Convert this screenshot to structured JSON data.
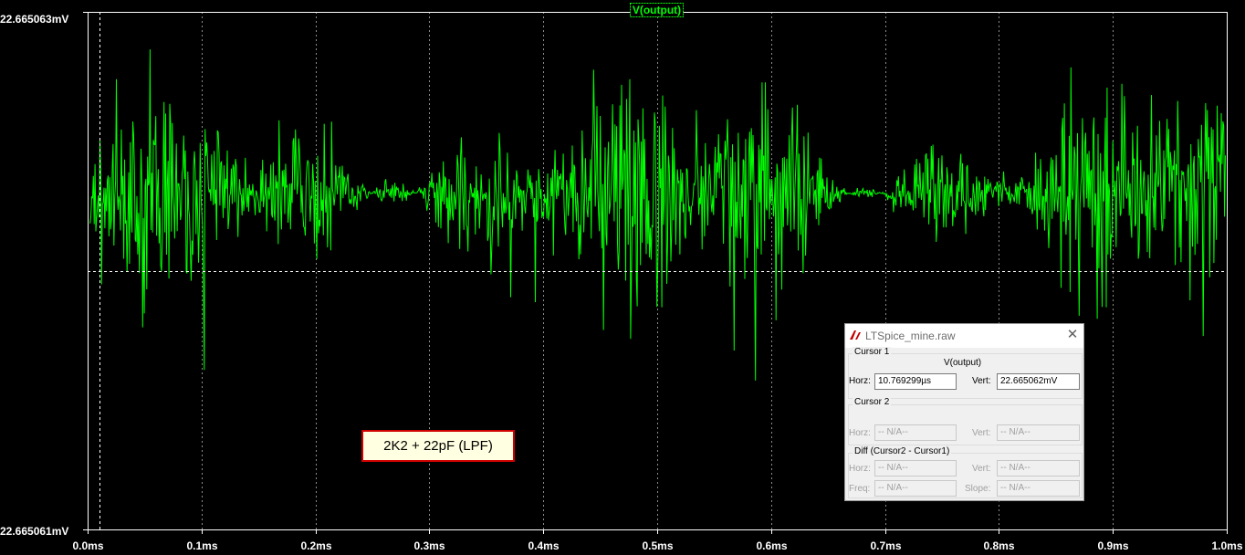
{
  "chart_data": {
    "type": "line",
    "title": "V(output)",
    "series": [
      {
        "name": "V(output)",
        "color": "#00ff00"
      }
    ],
    "x_ticks": [
      "0.0ms",
      "0.1ms",
      "0.2ms",
      "0.3ms",
      "0.4ms",
      "0.5ms",
      "0.6ms",
      "0.7ms",
      "0.8ms",
      "0.9ms",
      "1.0ms"
    ],
    "y_tick_top": "22.665063mV",
    "y_tick_bottom": "22.665061mV",
    "xlim_ms": [
      0.0,
      1.0
    ],
    "ylim_mV": [
      22.665061,
      22.665063
    ],
    "series_description_note_free": true,
    "noise_center_mV": 22.6650623,
    "cursor_x_ms": 0.010769299,
    "cursor_y_mV": 22.665062,
    "grid": true,
    "background": "#000000",
    "axis_color": "#ffffff",
    "grid_color": "#8c8c8c"
  },
  "annotation": {
    "text": "2K2 + 22pF (LPF)"
  },
  "cursor_window": {
    "title": "LTSpice_mine.raw",
    "close_glyph": "✕",
    "cursor1": {
      "label": "Cursor 1",
      "trace": "V(output)",
      "horz_label": "Horz:",
      "horz_value": "10.769299µs",
      "vert_label": "Vert:",
      "vert_value": "22.665062mV"
    },
    "cursor2": {
      "label": "Cursor 2",
      "horz_label": "Horz:",
      "horz_value": "-- N/A--",
      "vert_label": "Vert:",
      "vert_value": "-- N/A--"
    },
    "diff": {
      "label": "Diff (Cursor2 - Cursor1)",
      "horz_label": "Horz:",
      "horz_value": "-- N/A--",
      "vert_label": "Vert:",
      "vert_value": "-- N/A--",
      "freq_label": "Freq:",
      "freq_value": "-- N/A--",
      "slope_label": "Slope:",
      "slope_value": "-- N/A--"
    }
  }
}
